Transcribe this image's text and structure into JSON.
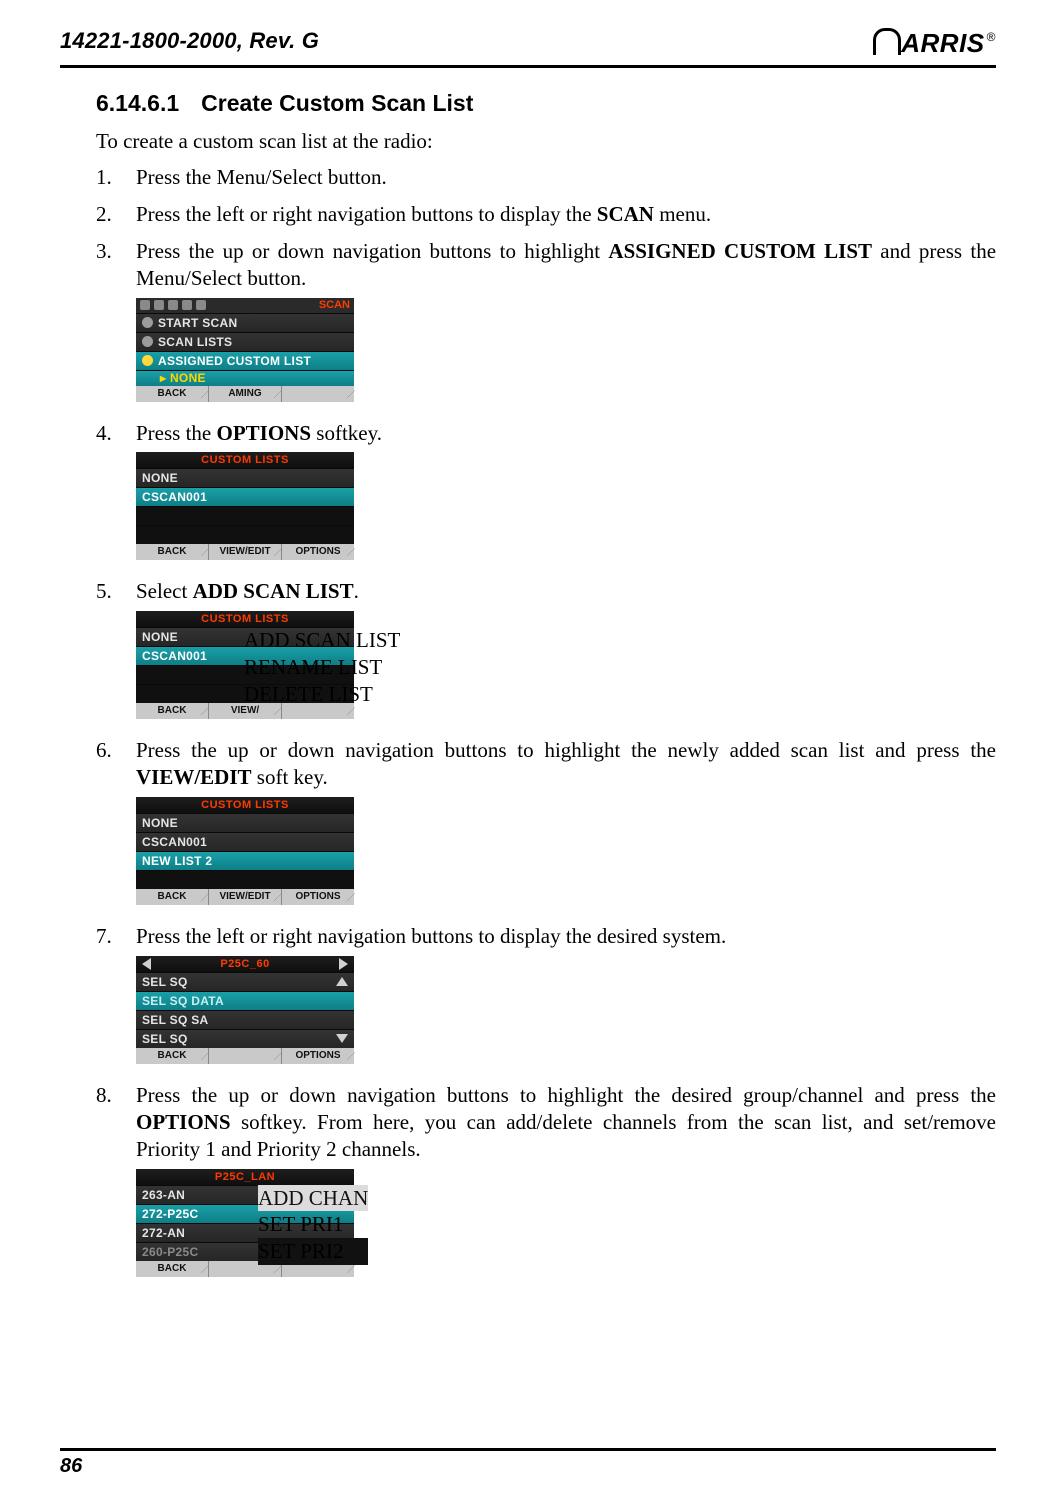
{
  "doc_id": "14221-1800-2000, Rev. G",
  "logo_text": "ARRIS",
  "section": {
    "number": "6.14.6.1",
    "title": "Create Custom Scan List"
  },
  "intro": "To create a custom scan list at the radio:",
  "steps": [
    {
      "pre": "Press the Menu/Select button."
    },
    {
      "pre": "Press the left or right navigation buttons to display the ",
      "b1": "SCAN",
      "post": " menu."
    },
    {
      "pre": "Press the up or down navigation buttons to highlight ",
      "b1": "ASSIGNED CUSTOM LIST",
      "post": " and press the Menu/Select button."
    },
    {
      "pre": "Press the ",
      "b1": "OPTIONS",
      "post": " softkey."
    },
    {
      "pre": "Select ",
      "b1": "ADD SCAN LIST",
      "post": "."
    },
    {
      "pre": "Press the up or down navigation buttons to highlight the newly added scan list and press the ",
      "b1": "VIEW/EDIT",
      "post": " soft key."
    },
    {
      "pre": "Press the left or right navigation buttons to display the desired system."
    },
    {
      "pre": "Press the up or down navigation buttons to highlight the desired group/channel and press the ",
      "b1": "OPTIONS",
      "post": " softkey.  From here, you can add/delete channels from the scan list, and set/remove Priority 1 and Priority 2 channels."
    }
  ],
  "shot3": {
    "topbar_label": "SCAN",
    "r1": "START SCAN",
    "r2": "SCAN LISTS",
    "r3": "ASSIGNED CUSTOM LIST",
    "r3_sub": "NONE",
    "sk1": "BACK",
    "sk2": "AMING"
  },
  "shot4": {
    "title": "CUSTOM LISTS",
    "r1": "NONE",
    "r2": "CSCAN001",
    "sk1": "BACK",
    "sk2": "VIEW/EDIT",
    "sk3": "OPTIONS"
  },
  "shot5": {
    "title": "CUSTOM LISTS",
    "r1": "NONE",
    "r2": "CSCAN001",
    "m1": "ADD SCAN LIST",
    "m2": "RENAME LIST",
    "m3": "DELETE LIST",
    "sk1": "BACK",
    "sk2": "VIEW/"
  },
  "shot6": {
    "title": "CUSTOM LISTS",
    "r1": "NONE",
    "r2": "CSCAN001",
    "r3": "NEW LIST 2",
    "sk1": "BACK",
    "sk2": "VIEW/EDIT",
    "sk3": "OPTIONS"
  },
  "shot7": {
    "title": "P25C_60",
    "r1": "SEL SQ",
    "r2": "SEL SQ DATA",
    "r3": "SEL SQ SA",
    "r4": "SEL SQ",
    "sk1": "BACK",
    "sk3": "OPTIONS"
  },
  "shot8": {
    "title": "P25C_LAN",
    "r1": "263-AN",
    "r2": "272-P25C",
    "r3": "272-AN",
    "r4": "260-P25C",
    "m1": "ADD CHAN",
    "m2": "SET PRI1",
    "m3": "SET PRI2",
    "sk1": "BACK"
  },
  "page_number": "86"
}
